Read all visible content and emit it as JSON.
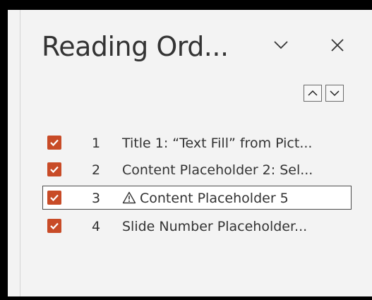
{
  "pane": {
    "title": "Reading Ord...",
    "options_icon": "chevron-down-icon",
    "close_icon": "close-icon",
    "move_up_icon": "chevron-up-icon",
    "move_down_icon": "chevron-down-icon"
  },
  "colors": {
    "checkbox": "#c84b27",
    "text": "#333333",
    "pane_bg": "#f3f3f3",
    "selection_border": "#4a4a4a"
  },
  "items": [
    {
      "checked": true,
      "number": "1",
      "label": "Title 1: “Text Fill” from Pict...",
      "warning": false
    },
    {
      "checked": true,
      "number": "2",
      "label": "Content Placeholder 2: Sel...",
      "warning": false
    },
    {
      "checked": true,
      "number": "3",
      "label": "Content Placeholder 5",
      "warning": true,
      "selected": true
    },
    {
      "checked": true,
      "number": "4",
      "label": "Slide Number Placeholder...",
      "warning": false
    }
  ]
}
